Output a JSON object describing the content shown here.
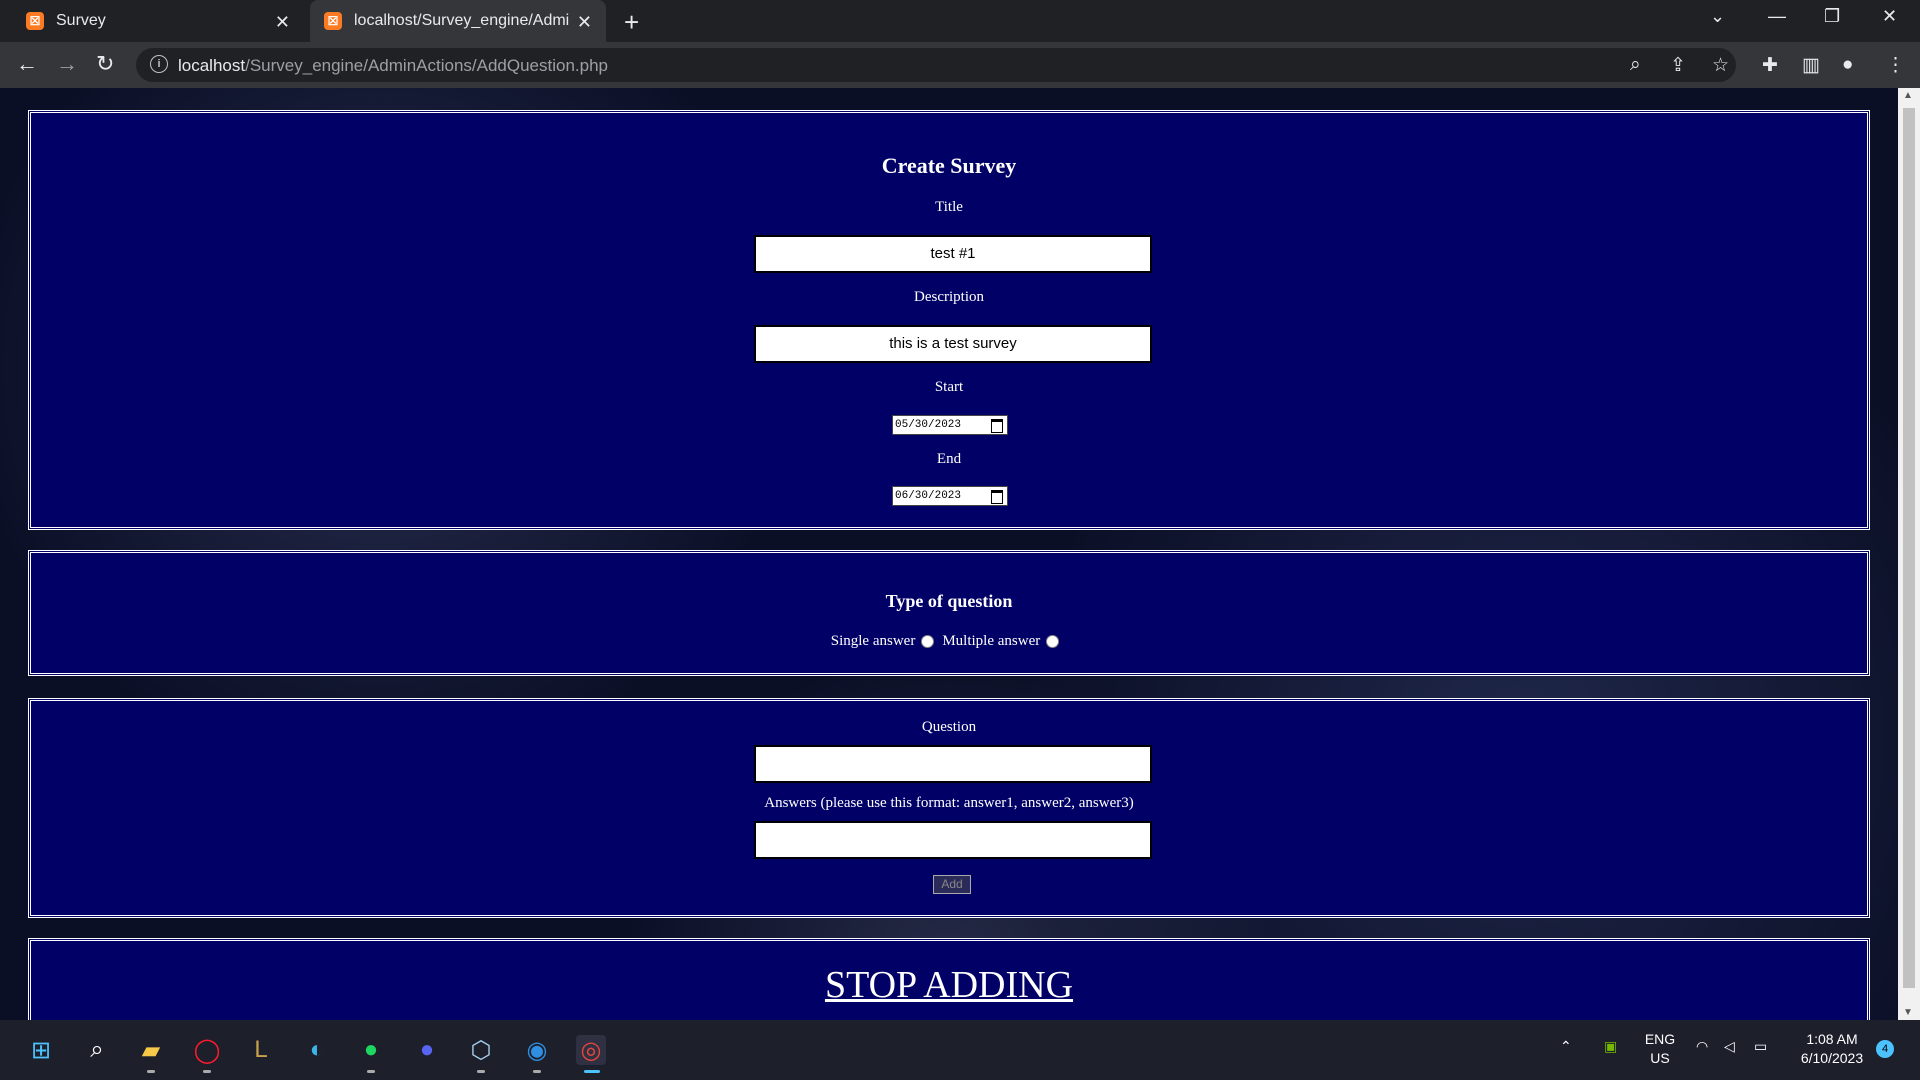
{
  "browser": {
    "tabs": [
      {
        "title": "Survey"
      },
      {
        "title": "localhost/Survey_engine/AdminActions/AddQuestion.php"
      }
    ],
    "url_host": "localhost",
    "url_path": "/Survey_engine/AdminActions/AddQuestion.php"
  },
  "form": {
    "heading": "Create Survey",
    "title_label": "Title",
    "title_value": "test #1",
    "description_label": "Description",
    "description_value": "this is a test survey",
    "start_label": "Start",
    "start_value": "05/30/2023",
    "end_label": "End",
    "end_value": "06/30/2023"
  },
  "question_type": {
    "heading": "Type of question",
    "single_label": "Single answer",
    "multiple_label": "Multiple answer"
  },
  "question": {
    "question_label": "Question",
    "question_value": "",
    "answers_label": "Answers (please use this format: answer1, answer2, answer3)",
    "answers_value": "",
    "add_label": "Add"
  },
  "stop_label": "STOP ADDING",
  "taskbar": {
    "lang_top": "ENG",
    "lang_bottom": "US",
    "time": "1:08 AM",
    "date": "6/10/2023",
    "notification_count": "4"
  },
  "colors": {
    "panel_bg": "#010066",
    "tab_favicon": "#fb7a24"
  }
}
